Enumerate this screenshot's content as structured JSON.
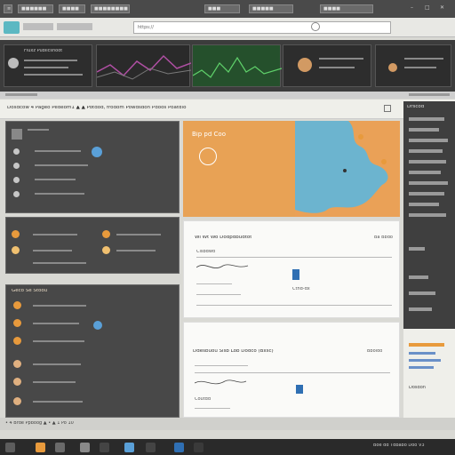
{
  "topbar": {
    "items": [
      "≡",
      "■■■■■■",
      "■■■■",
      "■■■■■■■■",
      "■■■",
      "■■■■■",
      "■■■■"
    ],
    "window_buttons": [
      "–",
      "□",
      "✕"
    ]
  },
  "address": {
    "url": "https://",
    "tab_label": "Fluxz Publicshoot"
  },
  "thumbnails": [
    {
      "label": "Fluxz Publicshoot",
      "accent": "#444444"
    },
    {
      "label": "",
      "accent": "#9b4a8f"
    },
    {
      "label": "",
      "accent": "#2f8a3c"
    },
    {
      "label": "",
      "accent": "#3b3b3b"
    },
    {
      "label": "",
      "accent": "#3b3b3b"
    }
  ],
  "context_bar": {
    "text": "Dosdcow 4 Pageo Pedeom1 ▲ ▲ Potdod, frodom Powdsdon Pdoos Poatdio"
  },
  "left_panels": {
    "panel1": {
      "rows": 6
    },
    "panel2": {
      "rows": 5
    },
    "panel3": {
      "header": "Geco  Se Stoou",
      "rows": 6
    }
  },
  "map_card": {
    "title": "Bip pd Coo",
    "map_color": "#6cb4cf",
    "bg_color": "#e8a255"
  },
  "doc1": {
    "title": "Wi Wt Wo Dodpdbudtot",
    "right_label": "Ba Bbdo",
    "sub_label": "Clsbdwd",
    "side_label": "Ctnd-dx"
  },
  "doc2": {
    "title": "Ddesbuou Sisb Lob Dodco (Bxsc)",
    "right_label": "Bboido",
    "sub_label": "Coutdd"
  },
  "right_sidebar": {
    "header": "Drscod",
    "items": 18,
    "footer": "Dosdon"
  },
  "status_bar": {
    "text": "• 4 Brde Ppboog ▲ • ▲ 1 Po 10"
  },
  "taskbar": {
    "clock": "Boe dd Tdbabo Doo V3"
  },
  "colors": {
    "accent_orange": "#e89a3c",
    "accent_blue": "#2f6fb3",
    "dark_panel": "#484848"
  }
}
